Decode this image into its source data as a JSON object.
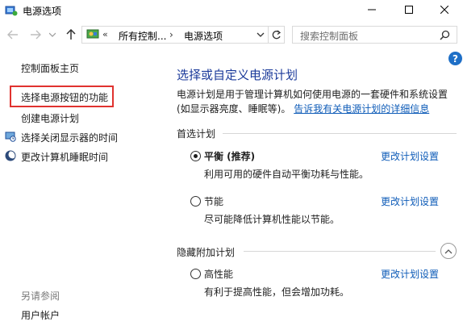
{
  "window": {
    "title": "电源选项",
    "controls": {
      "minimize": "minimize-icon",
      "maximize": "maximize-icon",
      "close": "close-icon"
    }
  },
  "nav": {
    "address_overflow": "«",
    "address_segments": [
      "所有控制...",
      "电源选项"
    ],
    "address_separator": "›",
    "search_placeholder": "搜索控制面板"
  },
  "sidebar": {
    "home": "控制面板主页",
    "items": [
      {
        "label": "选择电源按钮的功能",
        "highlighted": true
      },
      {
        "label": "创建电源计划",
        "highlighted": false
      },
      {
        "label": "选择关闭显示器的时间",
        "highlighted": false,
        "icon": "display-icon"
      },
      {
        "label": "更改计算机睡眠时间",
        "highlighted": false,
        "icon": "moon-icon"
      }
    ],
    "see_also": "另请参阅",
    "see_also_items": [
      "用户帐户"
    ]
  },
  "main": {
    "title": "选择或自定义电源计划",
    "description_line1": "电源计划是用于管理计算机如何使用电源的一套硬件和系统设置",
    "description_line2_text": "(如显示器亮度、睡眠等)。",
    "description_link": "告诉我有关电源计划的详细信息",
    "preferred_label": "首选计划",
    "hidden_label": "隐藏附加计划",
    "change_label": "更改计划设置",
    "plans": [
      {
        "name": "平衡 (推荐)",
        "desc": "利用可用的硬件自动平衡功耗与性能。",
        "selected": true
      },
      {
        "name": "节能",
        "desc": "尽可能降低计算机性能以节能。",
        "selected": false
      },
      {
        "name": "高性能",
        "desc": "有利于提高性能，但会增加功耗。",
        "selected": false
      }
    ]
  },
  "colors": {
    "title_blue": "#1b3a9a",
    "link_blue": "#0f5cb8",
    "highlight_red": "#e0322f",
    "help_blue": "#1e6fc7"
  }
}
